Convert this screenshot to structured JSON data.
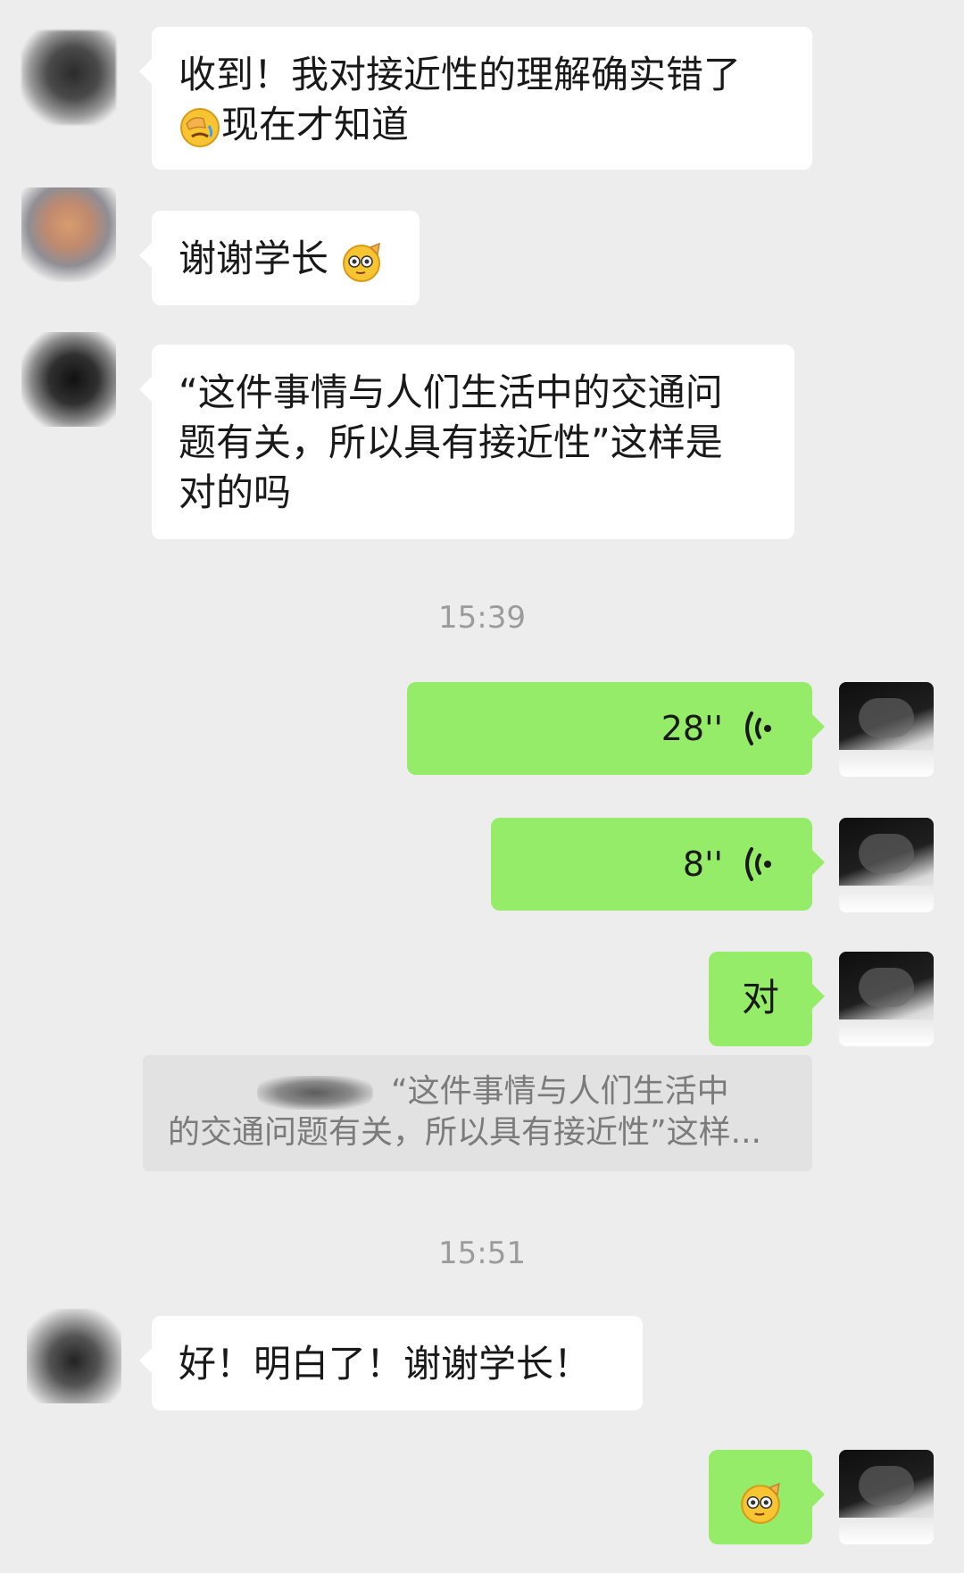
{
  "messages": {
    "m1": {
      "line1": "收到！我对接近性的理解确实错了",
      "line2": "现在才知道"
    },
    "m2": {
      "text": "谢谢学长"
    },
    "m3": {
      "line1": "“这件事情与人们生活中的交通问",
      "line2": "题有关，所以具有接近性”这样是",
      "line3": "对的吗"
    },
    "time1": "15:39",
    "voice1": {
      "length": "28''"
    },
    "voice2": {
      "length": "8''"
    },
    "m6": {
      "text": "对"
    },
    "quote": {
      "line1": "“这件事情与人们生活中",
      "line2": "的交通问题有关，所以具有接近性”这样..."
    },
    "time2": "15:51",
    "m7": {
      "text": "好！明白了！谢谢学长！"
    }
  },
  "icons": {
    "voice": "voice-wave-icon",
    "emoji_facepalm": "facepalm-emoji-icon",
    "emoji_salute": "salute-emoji-icon"
  },
  "colors": {
    "background": "#ededed",
    "sent_bubble": "#95ec69",
    "received_bubble": "#ffffff",
    "timestamp": "#9b9b9b"
  }
}
